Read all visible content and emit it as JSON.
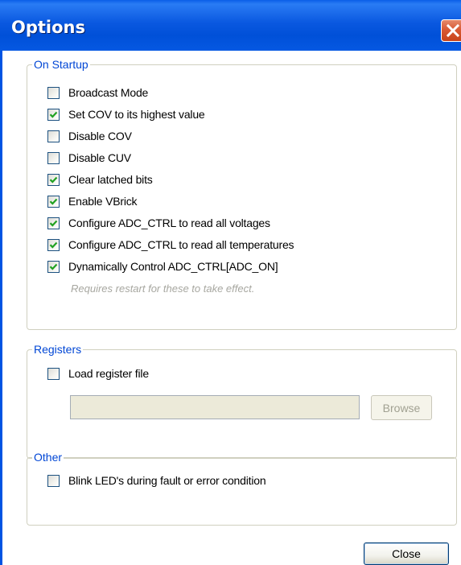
{
  "window": {
    "title": "Options"
  },
  "on_startup": {
    "legend": "On Startup",
    "items": [
      {
        "label": "Broadcast Mode",
        "checked": false
      },
      {
        "label": "Set COV to its highest value",
        "checked": true
      },
      {
        "label": "Disable COV",
        "checked": false
      },
      {
        "label": "Disable CUV",
        "checked": false
      },
      {
        "label": "Clear latched bits",
        "checked": true
      },
      {
        "label": "Enable VBrick",
        "checked": true
      },
      {
        "label": "Configure ADC_CTRL to read all voltages",
        "checked": true
      },
      {
        "label": "Configure ADC_CTRL to read all temperatures",
        "checked": true
      },
      {
        "label": "Dynamically Control ADC_CTRL[ADC_ON]",
        "checked": true
      }
    ],
    "hint": "Requires restart for these to take effect."
  },
  "registers": {
    "legend": "Registers",
    "load_label": "Load register file",
    "load_checked": false,
    "file_path": "",
    "browse_label": "Browse"
  },
  "other": {
    "legend": "Other",
    "blink_label": "Blink LED's during fault or error condition",
    "blink_checked": false
  },
  "footer": {
    "close_label": "Close"
  },
  "colors": {
    "titlebar": "#0054e3",
    "legend_text": "#0046d5",
    "check_mark": "#21a121",
    "close_button": "#d95a34"
  }
}
